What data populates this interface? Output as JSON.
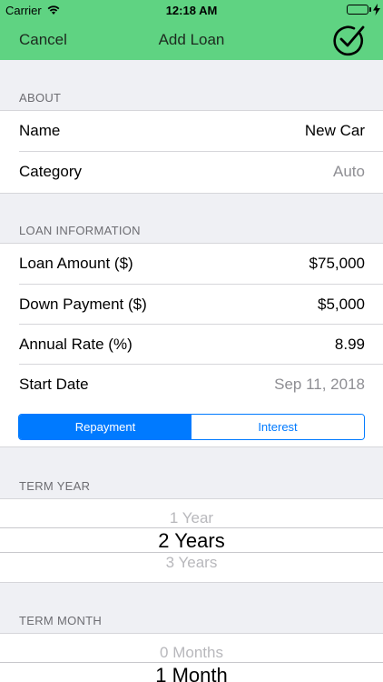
{
  "status_bar": {
    "carrier": "Carrier",
    "time": "12:18 AM"
  },
  "nav": {
    "cancel_label": "Cancel",
    "title": "Add Loan"
  },
  "about": {
    "header": "ABOUT",
    "name_label": "Name",
    "name_value": "New Car",
    "category_label": "Category",
    "category_value": "Auto"
  },
  "loan_info": {
    "header": "LOAN INFORMATION",
    "amount_label": "Loan Amount ($)",
    "amount_value": "$75,000",
    "down_label": "Down Payment ($)",
    "down_value": "$5,000",
    "rate_label": "Annual Rate (%)",
    "rate_value": "8.99",
    "start_label": "Start Date",
    "start_value": "Sep 11, 2018"
  },
  "segmented": {
    "option_1": "Repayment",
    "option_2": "Interest",
    "selected": "Repayment"
  },
  "term_year": {
    "header": "TERM YEAR",
    "above": "1 Year",
    "selected": "2 Years",
    "below": "3 Years"
  },
  "term_month": {
    "header": "TERM MONTH",
    "above": "0 Months",
    "selected": "1 Month"
  },
  "colors": {
    "nav_bg": "#5fd382",
    "accent": "#007aff",
    "background": "#eff0f4",
    "muted_text": "#8e8e93"
  }
}
